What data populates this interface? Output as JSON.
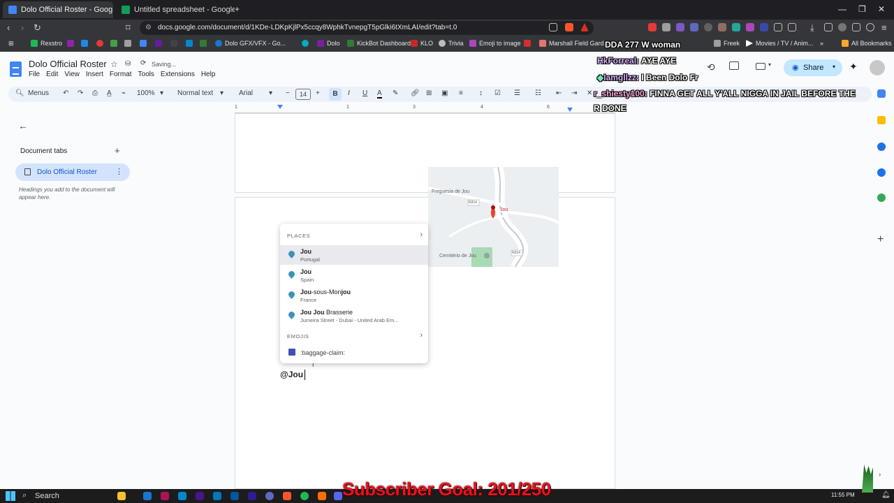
{
  "browser": {
    "tabs": [
      {
        "title": "Dolo Official Roster - Google Do",
        "active": true
      },
      {
        "title": "Untitled spreadsheet - Google Sheets",
        "active": false
      }
    ],
    "new_tab": "+",
    "url": "docs.google.com/document/d/1KDe-LDKpKjlPx5ccqy8WphkTvnepgT5pGlki6tXmLAI/edit?tab=t.0",
    "bookmarks": [
      "Rexstro",
      "Dolo GFX/VFX - Go...",
      "Dolo",
      "KickBot Dashboard",
      "KLO",
      "Trivia",
      "Emoji to image",
      "Marshall Field Gard...",
      "Freek",
      "Movies / TV / Anim..."
    ],
    "all_bookmarks": "All Bookmarks"
  },
  "docs": {
    "title": "Dolo Official Roster",
    "status": "Saving...",
    "menu": [
      "File",
      "Edit",
      "View",
      "Insert",
      "Format",
      "Tools",
      "Extensions",
      "Help"
    ],
    "share": "Share",
    "toolbar": {
      "menus": "Menus",
      "zoom": "100%",
      "style": "Normal text",
      "font": "Arial",
      "size": "14"
    },
    "ruler_ticks": [
      "1",
      "1",
      "2",
      "3",
      "4",
      "5",
      "6"
    ],
    "sidebar": {
      "header": "Document tabs",
      "add": "+",
      "tab_label": "Dolo Official Roster",
      "hint": "Headings you add to the document will appear here."
    },
    "map_labels": [
      "Freguesia de Jou",
      "Jou",
      "Cemitério de Jou"
    ],
    "road_labels": [
      "N314",
      "N314"
    ],
    "typed_text": "@Jou",
    "dropdown": {
      "places_header": "PLACES",
      "places": [
        {
          "name_bold": "Jou",
          "name_rest": "",
          "sub": "Portugal"
        },
        {
          "name_bold": "Jou",
          "name_rest": "",
          "sub": "Spain"
        },
        {
          "name_bold": "Jou",
          "name_rest": "-sous-Mon",
          "name_bold2": "jou",
          "sub": "France"
        },
        {
          "name_bold": "Jou Jou",
          "name_rest": " Brasserie",
          "sub": "Jumeira Street - Dubai - United Arab Em..."
        }
      ],
      "emojis_header": "EMOJIS",
      "emoji_label": ":baggage-claim:"
    }
  },
  "overlay": {
    "chat": [
      {
        "user": "DDA",
        "text": "277 W woman"
      },
      {
        "user": "HkForreal",
        "text": ": AYE AYE"
      },
      {
        "user": "Iamgllzz",
        "text": ": I Been Dolo Fr"
      },
      {
        "user": "r_shiesty100",
        "text": ": FINNA GET ALL Y'ALL NIGGA IN JAIL BEFORE THE"
      },
      {
        "user": "",
        "text": "R DONE"
      }
    ],
    "subscriber_goal": "Subscriber Goal: 201/250"
  },
  "taskbar": {
    "search": "Search",
    "clock": "11:55 PM"
  },
  "colors": {
    "accent": "#0b57d0",
    "chip": "#d3e3fd",
    "toolbar_bg": "#edf2fa",
    "goal_red": "#e8121e"
  }
}
